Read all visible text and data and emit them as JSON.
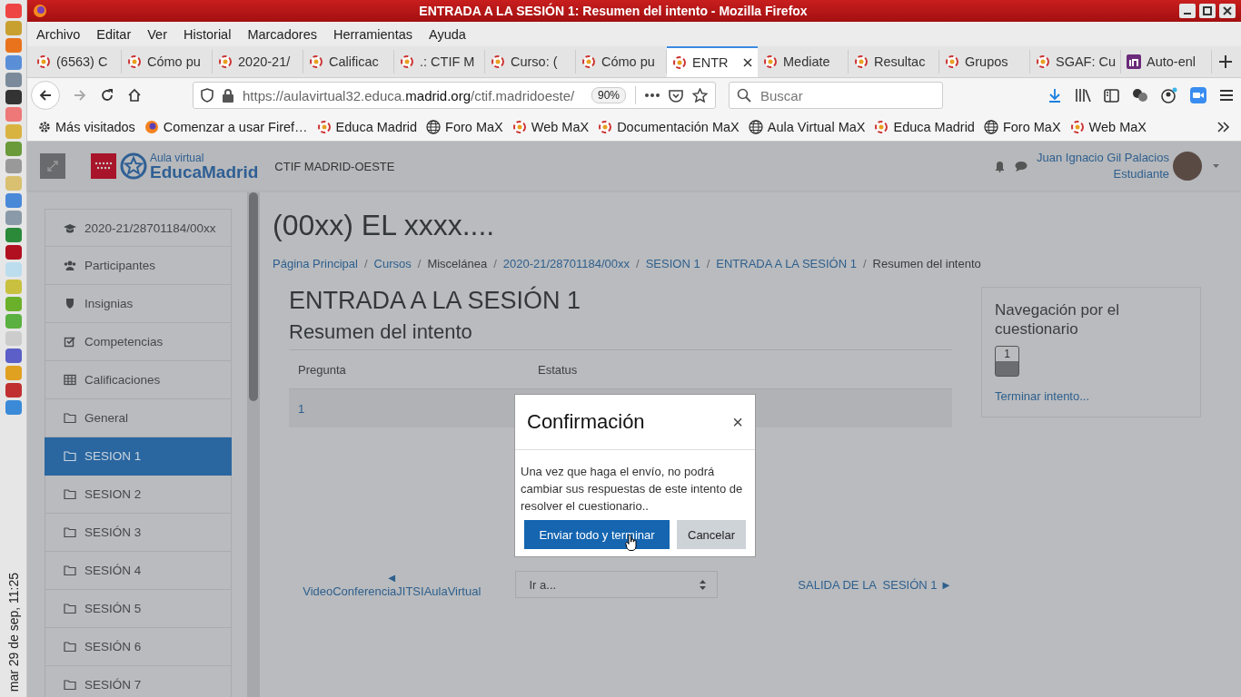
{
  "window": {
    "title": "ENTRADA A LA SESIÓN 1: Resumen del intento - Mozilla Firefox"
  },
  "dock": {
    "clock": "mar 29 de sep, 11:25"
  },
  "menu": [
    "Archivo",
    "Editar",
    "Ver",
    "Historial",
    "Marcadores",
    "Herramientas",
    "Ayuda"
  ],
  "tabs": [
    {
      "label": "(6563) C",
      "kind": "site",
      "selected": false
    },
    {
      "label": "Cómo pu",
      "kind": "site",
      "selected": false
    },
    {
      "label": "2020-21/",
      "kind": "site",
      "selected": false
    },
    {
      "label": "Calificac",
      "kind": "site",
      "selected": false
    },
    {
      "label": ".: CTIF M",
      "kind": "site",
      "selected": false
    },
    {
      "label": "Curso: (",
      "kind": "site",
      "selected": false
    },
    {
      "label": "Cómo pu",
      "kind": "site",
      "selected": false
    },
    {
      "label": "ENTR",
      "kind": "site",
      "selected": true
    },
    {
      "label": "Mediate",
      "kind": "site",
      "selected": false
    },
    {
      "label": "Resultac",
      "kind": "site",
      "selected": false
    },
    {
      "label": "Grupos",
      "kind": "site",
      "selected": false
    },
    {
      "label": "SGAF: Cu",
      "kind": "site",
      "selected": false
    },
    {
      "label": "Auto-enl",
      "kind": "app",
      "selected": false
    }
  ],
  "address": {
    "url": "https://aulavirtual32.educa.**madrid.org**/ctif.madridoeste/",
    "zoom": "90%"
  },
  "search": {
    "placeholder": "Buscar"
  },
  "bookmarks": [
    {
      "label": "Más visitados",
      "kind": "smart"
    },
    {
      "label": "Comenzar a usar Firef…",
      "kind": "browser"
    },
    {
      "label": "Educa Madrid",
      "kind": "site"
    },
    {
      "label": "Foro MaX",
      "kind": "web"
    },
    {
      "label": "Web MaX",
      "kind": "site"
    },
    {
      "label": "Documentación MaX",
      "kind": "site"
    },
    {
      "label": "Aula Virtual MaX",
      "kind": "web"
    },
    {
      "label": "Educa Madrid",
      "kind": "site"
    },
    {
      "label": "Foro MaX",
      "kind": "web"
    },
    {
      "label": "Web MaX",
      "kind": "site"
    }
  ],
  "header": {
    "logo_top": "Aula virtual",
    "logo_bottom": "EducaMadrid",
    "site": "CTIF MADRID-OESTE",
    "user": "Juan Ignacio Gil Palacios",
    "role": "Estudiante"
  },
  "sidebar": {
    "items": [
      {
        "label": "2020-21/28701184/00xx",
        "kind": "course",
        "selected": false
      },
      {
        "label": "Participantes",
        "kind": "participants",
        "selected": false
      },
      {
        "label": "Insignias",
        "kind": "badges",
        "selected": false
      },
      {
        "label": "Competencias",
        "kind": "competencies",
        "selected": false
      },
      {
        "label": "Calificaciones",
        "kind": "grades",
        "selected": false
      },
      {
        "label": "General",
        "kind": "section",
        "selected": false
      },
      {
        "label": "SESION 1",
        "kind": "section",
        "selected": true
      },
      {
        "label": "SESION 2",
        "kind": "section",
        "selected": false
      },
      {
        "label": "SESIÓN 3",
        "kind": "section",
        "selected": false
      },
      {
        "label": "SESIÓN 4",
        "kind": "section",
        "selected": false
      },
      {
        "label": "SESIÓN 5",
        "kind": "section",
        "selected": false
      },
      {
        "label": "SESIÓN 6",
        "kind": "section",
        "selected": false
      },
      {
        "label": "SESIÓN 7",
        "kind": "section",
        "selected": false
      }
    ]
  },
  "page": {
    "title": "(00xx) EL xxxx....",
    "breadcrumbs": [
      {
        "label": "Página Principal",
        "link": true,
        "sep": "/"
      },
      {
        "label": "Cursos",
        "link": true,
        "sep": "/"
      },
      {
        "label": "Miscelánea",
        "link": false,
        "sep": "/"
      },
      {
        "label": "2020-21/28701184/00xx",
        "link": true,
        "sep": "/"
      },
      {
        "label": "SESION 1",
        "link": true,
        "sep": "/"
      },
      {
        "label": "ENTRADA A LA SESIÓN 1",
        "link": true,
        "sep": "/"
      },
      {
        "label": "Resumen del intento",
        "link": false
      }
    ]
  },
  "quiz": {
    "title": "ENTRADA A LA SESIÓN 1",
    "subtitle": "Resumen del intento",
    "columns": [
      "Pregunta",
      "Estatus"
    ],
    "rows": [
      [
        "1"
      ]
    ]
  },
  "quiz_nav": {
    "title": "Navegación por el cuestionario",
    "questions": [
      "1"
    ],
    "finish": "Terminar intento..."
  },
  "pager": {
    "prev_arrow": "◄",
    "prev": "VideoConferenciaJITSIAulaVirtual",
    "jump": "Ir a...",
    "next": "SALIDA DE LA  SESIÓN 1 ►"
  },
  "dialog": {
    "title": "Confirmación",
    "close": "×",
    "message": "Una vez que haga el envío, no podrá cambiar sus respuestas de este intento de resolver el cuestionario..",
    "buttons": [
      {
        "label": "Enviar todo y terminar",
        "kind": "primary"
      },
      {
        "label": "Cancelar",
        "kind": "secondary"
      }
    ]
  }
}
